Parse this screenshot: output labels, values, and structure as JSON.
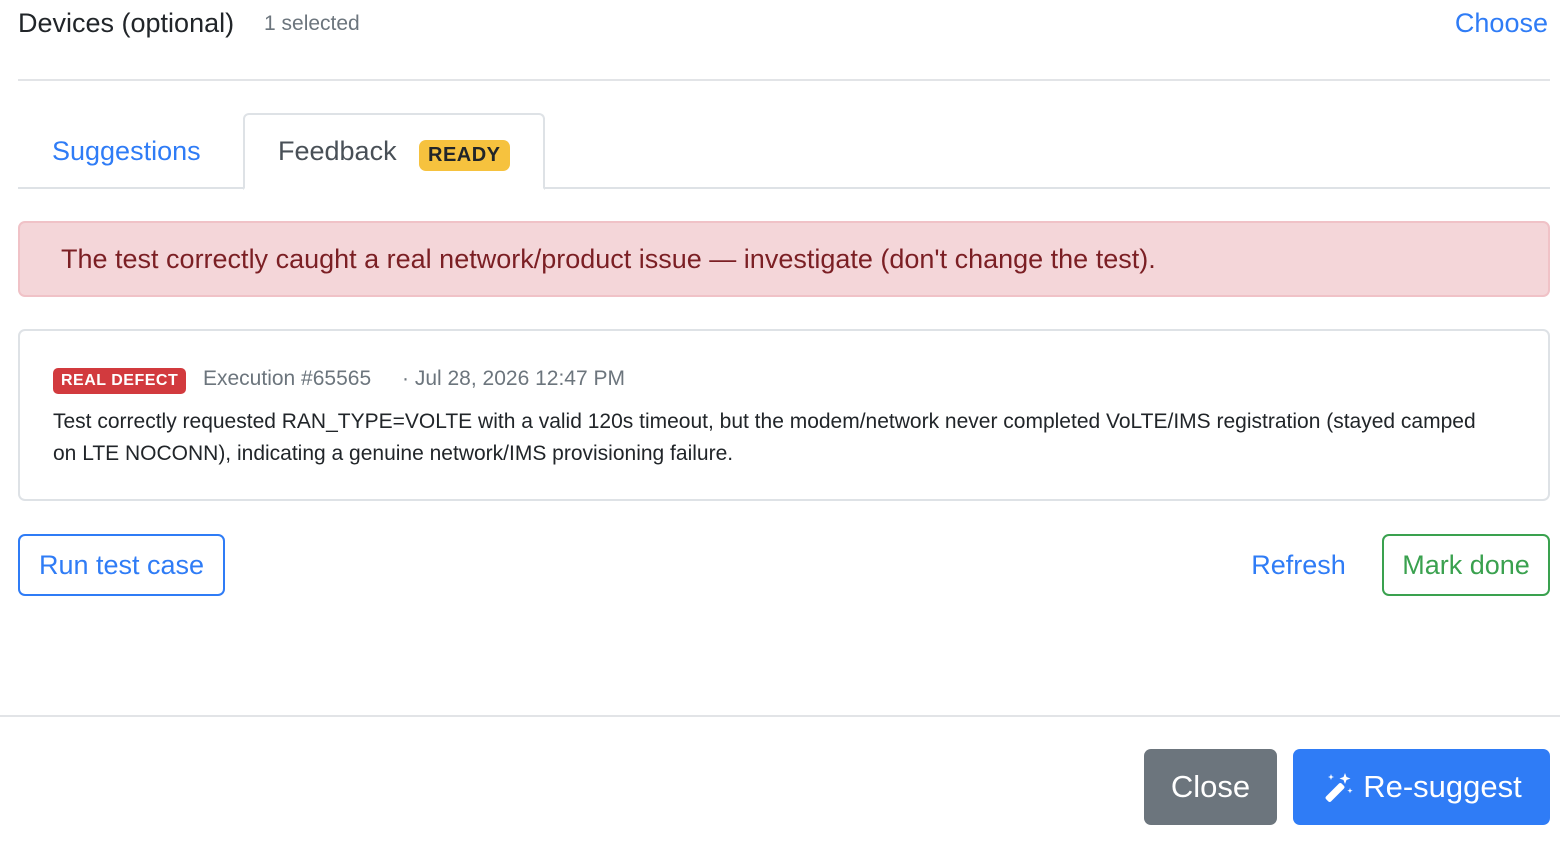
{
  "devices": {
    "title": "Devices (optional)",
    "selected_count": "1 selected",
    "choose_label": "Choose"
  },
  "tabs": [
    {
      "label": "Suggestions",
      "active": false
    },
    {
      "label": "Feedback",
      "active": true,
      "badge": "READY"
    }
  ],
  "alert": {
    "message": "The test correctly caught a real network/product issue — investigate (don't change the test)."
  },
  "feedback_card": {
    "badge": "REAL DEFECT",
    "execution": "Execution #65565",
    "date": "· Jul 28, 2026 12:47 PM",
    "body": "Test correctly requested RAN_TYPE=VOLTE with a valid 120s timeout, but the modem/network never completed VoLTE/IMS registration (stayed camped on LTE NOCONN), indicating a genuine network/IMS provisioning failure."
  },
  "actions": {
    "run_label": "Run test case",
    "refresh_label": "Refresh",
    "mark_done_label": "Mark done"
  },
  "footer": {
    "close_label": "Close",
    "resuggest_label": "Re-suggest",
    "resuggest_icon": "magic-wand-icon"
  },
  "colors": {
    "primary": "#2f7cf6",
    "success": "#3aa14f",
    "danger": "#d23a3e",
    "warning": "#f6c23e",
    "secondary": "#6c757d",
    "alert_bg": "#f4d6d9",
    "alert_text": "#7b1f24"
  }
}
